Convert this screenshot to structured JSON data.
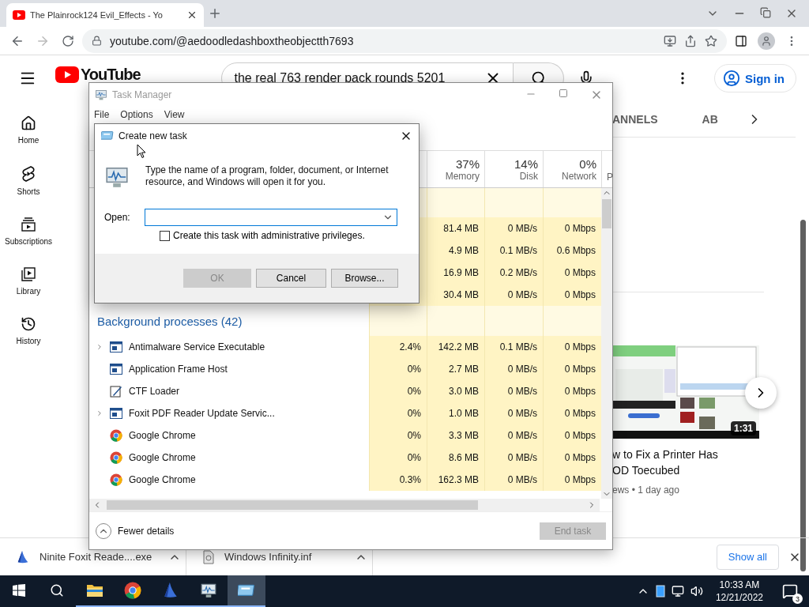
{
  "browser": {
    "tab": {
      "title": "The Plainrock124 Evil_Effects - Yo"
    },
    "address": "youtube.com/@aedoodledashboxtheobjectth7693"
  },
  "youtube": {
    "logo": "YouTube",
    "search": {
      "value": "the real 763 render pack rounds 5201"
    },
    "sign_in": "Sign in",
    "nav": [
      {
        "kind": "home",
        "label": "Home"
      },
      {
        "kind": "shorts",
        "label": "Shorts"
      },
      {
        "kind": "subscriptions",
        "label": "Subscriptions"
      },
      {
        "kind": "library",
        "label": "Library"
      },
      {
        "kind": "history",
        "label": "History"
      }
    ],
    "channel_tabs": [
      {
        "label": "ANNELS"
      },
      {
        "label": "AB"
      }
    ],
    "video": {
      "duration": "1:31",
      "title_lines": [
        "w to Fix a Printer Has",
        "OD Toecubed"
      ],
      "meta": "ews • 1 day ago"
    }
  },
  "task_manager": {
    "title": "Task Manager",
    "menu": [
      "File",
      "Options",
      "View"
    ],
    "columns": [
      {
        "percent": "37%",
        "label": "Memory"
      },
      {
        "percent": "14%",
        "label": "Disk"
      },
      {
        "percent": "0%",
        "label": "Network"
      },
      {
        "label": "P"
      }
    ],
    "app_rows": [
      {
        "memory": "81.4 MB",
        "disk": "0 MB/s",
        "network": "0 Mbps"
      },
      {
        "memory": "4.9 MB",
        "disk": "0.1 MB/s",
        "network": "0.6 Mbps"
      },
      {
        "memory": "16.9 MB",
        "disk": "0.2 MB/s",
        "network": "0 Mbps"
      },
      {
        "memory": "30.4 MB",
        "disk": "0 MB/s",
        "network": "0 Mbps"
      }
    ],
    "background_heading": "Background processes (42)",
    "background_rows": [
      {
        "name": "Antimalware Service Executable",
        "kind": "window",
        "expandable": true,
        "cpu": "2.4%",
        "memory": "142.2 MB",
        "disk": "0.1 MB/s",
        "network": "0 Mbps"
      },
      {
        "name": "Application Frame Host",
        "kind": "window",
        "expandable": false,
        "cpu": "0%",
        "memory": "2.7 MB",
        "disk": "0 MB/s",
        "network": "0 Mbps"
      },
      {
        "name": "CTF Loader",
        "kind": "pen",
        "expandable": false,
        "cpu": "0%",
        "memory": "3.0 MB",
        "disk": "0 MB/s",
        "network": "0 Mbps"
      },
      {
        "name": "Foxit PDF Reader Update Servic...",
        "kind": "window",
        "expandable": true,
        "cpu": "0%",
        "memory": "1.0 MB",
        "disk": "0 MB/s",
        "network": "0 Mbps"
      },
      {
        "name": "Google Chrome",
        "kind": "chrome",
        "expandable": false,
        "cpu": "0%",
        "memory": "3.3 MB",
        "disk": "0 MB/s",
        "network": "0 Mbps"
      },
      {
        "name": "Google Chrome",
        "kind": "chrome",
        "expandable": false,
        "cpu": "0%",
        "memory": "8.6 MB",
        "disk": "0 MB/s",
        "network": "0 Mbps"
      },
      {
        "name": "Google Chrome",
        "kind": "chrome",
        "expandable": false,
        "cpu": "0.3%",
        "memory": "162.3 MB",
        "disk": "0 MB/s",
        "network": "0 Mbps"
      }
    ],
    "fewer_details": "Fewer details",
    "end_task": {
      "label": "End task",
      "disabled": true
    }
  },
  "dialog": {
    "title": "Create new task",
    "message": "Type the name of a program, folder, document, or Internet resource, and Windows will open it for you.",
    "open_label": "Open:",
    "admin": {
      "label": "Create this task with administrative privileges.",
      "checked": false
    },
    "buttons": [
      {
        "label": "OK",
        "disabled": true
      },
      {
        "label": "Cancel",
        "disabled": false
      },
      {
        "label": "Browse...",
        "disabled": false
      }
    ]
  },
  "downloads": {
    "items": [
      {
        "kind": "ninite",
        "name": "Ninite Foxit Reade....exe"
      },
      {
        "kind": "file",
        "name": "Windows Infinity.inf"
      }
    ],
    "show_all": "Show all"
  },
  "taskbar": {
    "apps": [
      {
        "kind": "folder",
        "selected": false
      },
      {
        "kind": "chrome",
        "selected": false
      },
      {
        "kind": "ninite",
        "selected": false
      },
      {
        "kind": "taskmgr",
        "selected": false
      },
      {
        "kind": "run",
        "selected": true
      }
    ],
    "time": "10:33 AM",
    "date": "12/21/2022",
    "notifications": "3"
  }
}
